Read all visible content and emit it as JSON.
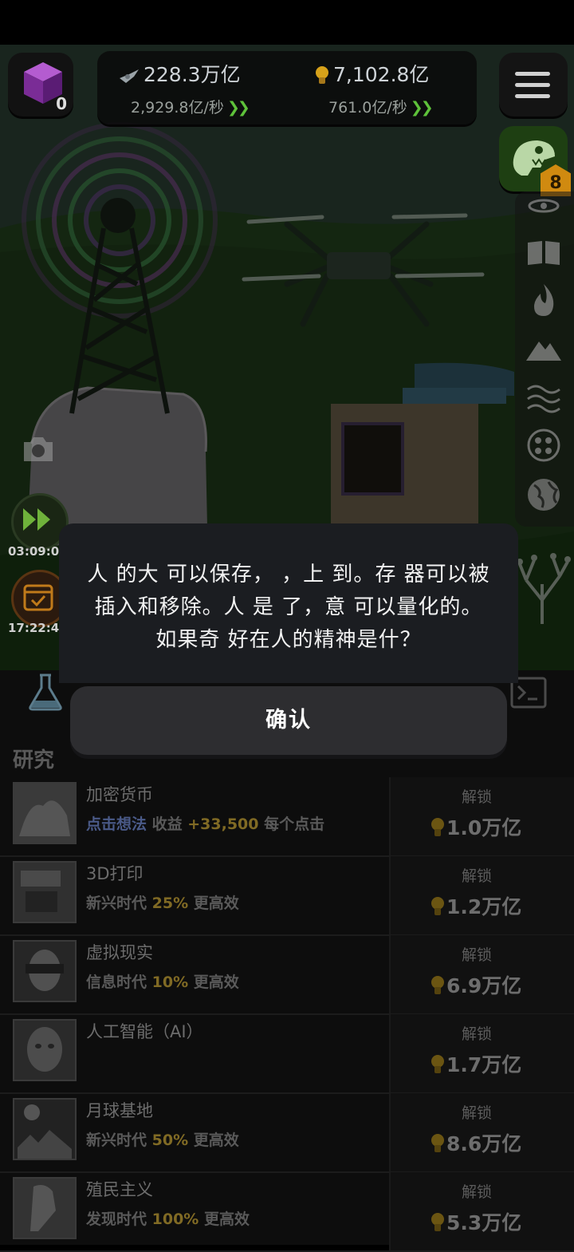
{
  "hud": {
    "cube_count": "0",
    "resource1": {
      "icon": "drone-icon",
      "value": "228.3万亿",
      "rate": "2,929.8亿/秒"
    },
    "resource2": {
      "icon": "lightbulb-icon",
      "value": "7,102.8亿",
      "rate": "761.0亿/秒"
    },
    "dino_badge": "8"
  },
  "left": {
    "timer1": "03:09:0",
    "timer2": "17:22:4"
  },
  "dialog": {
    "line1": "人 的大 可以保存，  ，上 到。存 器可以被",
    "line2": "插入和移除。人 是 了，意 可以量化的。",
    "line3": "如果奇   好在人的精神是什？",
    "confirm_label": "确认"
  },
  "research": {
    "title": "研究",
    "unlock_label": "解锁",
    "items": [
      {
        "name": "加密货币",
        "desc_pre": "",
        "desc_hl2": "点击想法",
        "desc_mid": " 收益 ",
        "desc_hl": "+33,500",
        "desc_post": " 每个点击",
        "price": "1.0万亿"
      },
      {
        "name": "3D打印",
        "desc_pre": "新兴时代 ",
        "desc_hl2": "",
        "desc_mid": "",
        "desc_hl": "25%",
        "desc_post": " 更高效",
        "price": "1.2万亿"
      },
      {
        "name": "虚拟现实",
        "desc_pre": "信息时代 ",
        "desc_hl2": "",
        "desc_mid": "",
        "desc_hl": "10%",
        "desc_post": " 更高效",
        "price": "6.9万亿"
      },
      {
        "name": "人工智能（AI）",
        "desc_pre": "",
        "desc_hl2": "",
        "desc_mid": "",
        "desc_hl": "",
        "desc_post": "",
        "price": "1.7万亿"
      },
      {
        "name": "月球基地",
        "desc_pre": "新兴时代 ",
        "desc_hl2": "",
        "desc_mid": "",
        "desc_hl": "50%",
        "desc_post": " 更高效",
        "price": "8.6万亿"
      },
      {
        "name": "殖民主义",
        "desc_pre": "发现时代 ",
        "desc_hl2": "",
        "desc_mid": "",
        "desc_hl": "100%",
        "desc_post": " 更高效",
        "price": "5.3万亿"
      }
    ]
  }
}
